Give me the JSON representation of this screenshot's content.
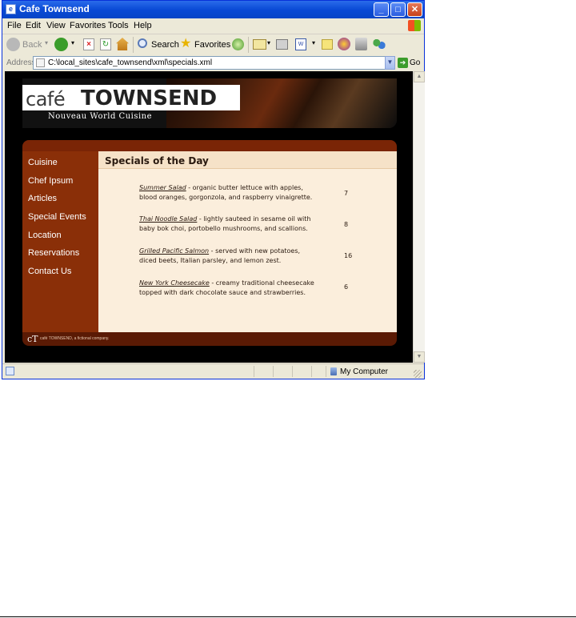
{
  "window": {
    "title": "Cafe Townsend",
    "controls": {
      "minimize": "_",
      "maximize": "□",
      "close": "✕"
    }
  },
  "menubar": [
    "File",
    "Edit",
    "View",
    "Favorites",
    "Tools",
    "Help"
  ],
  "toolbar": {
    "back_label": "Back",
    "search_label": "Search",
    "favorites_label": "Favorites"
  },
  "address": {
    "label": "Address",
    "url": "C:\\local_sites\\cafe_townsend\\xml\\specials.xml",
    "go_label": "Go"
  },
  "site": {
    "logo_cafe": "café",
    "logo_townsend": "TOWNSEND",
    "tagline": "Nouveau World Cuisine",
    "nav": [
      "Cuisine",
      "Chef Ipsum",
      "Articles",
      "Special Events",
      "Location",
      "Reservations",
      "Contact Us"
    ],
    "content_title": "Specials of the Day",
    "specials": [
      {
        "name": "Summer Salad",
        "desc": " - organic butter lettuce with apples, blood oranges, gorgonzola, and raspberry vinaigrette.",
        "price": "7"
      },
      {
        "name": "Thai Noodle Salad",
        "desc": " - lightly sauteed in sesame oil with baby bok choi, portobello mushrooms, and scallions.",
        "price": "8"
      },
      {
        "name": "Grilled Pacific Salmon",
        "desc": " - served with new potatoes, diced beets, Italian parsley, and lemon zest.",
        "price": "16"
      },
      {
        "name": "New York Cheesecake",
        "desc": " - creamy traditional cheesecake topped with dark chocolate sauce and strawberries.",
        "price": "6"
      }
    ],
    "footer_logo": "cT",
    "footer_text": "café TOWNSEND, a fictional company."
  },
  "statusbar": {
    "zone": "My Computer"
  },
  "colors": {
    "titlebar": "#0a4ad6",
    "sidebar": "#8a2f08",
    "content_bg": "#fbeedc",
    "footer": "#5a1a04"
  }
}
